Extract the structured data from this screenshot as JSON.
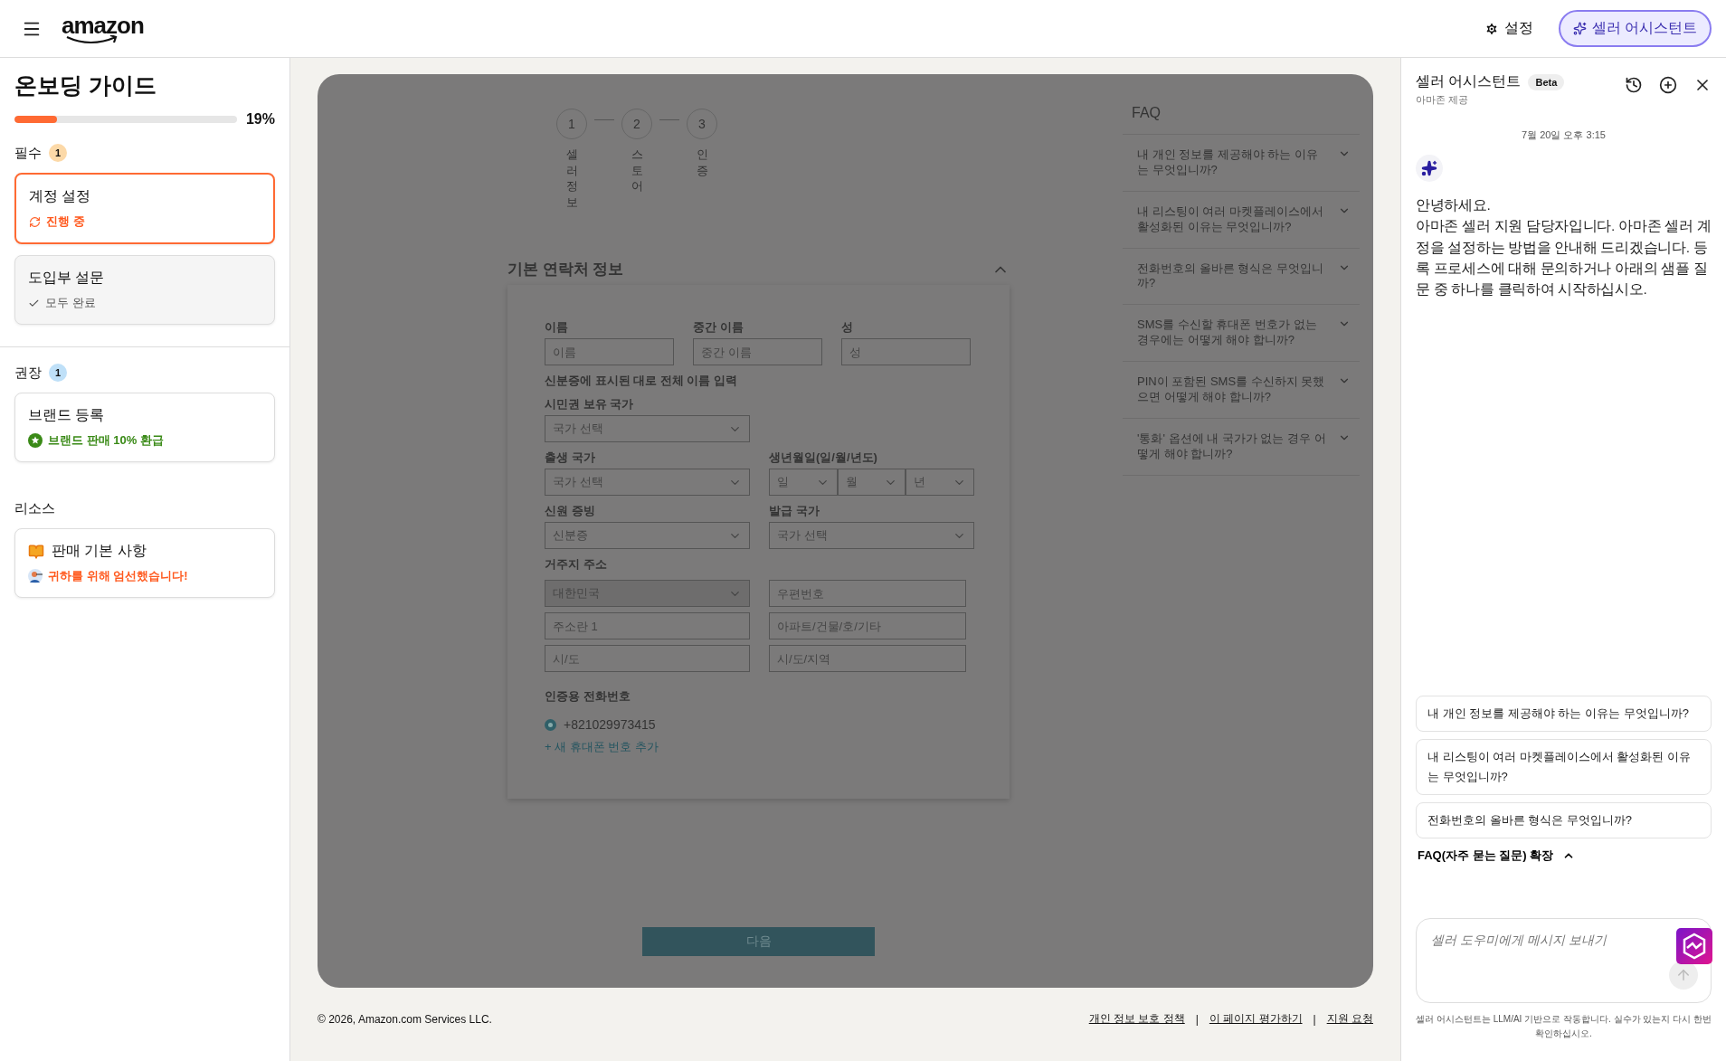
{
  "header": {
    "logo": "amazon",
    "settings": "설정",
    "assistant_button": "셀러 어시스턴트"
  },
  "sidebar": {
    "title": "온보딩 가이드",
    "progress": {
      "level": 0.19,
      "reading": "19%"
    },
    "sections": [
      {
        "title": "필수",
        "count": "1",
        "color": "#fcd9a8",
        "cards": [
          {
            "kind": "in_progress",
            "title": "계정 설정",
            "status": "진행 중",
            "selected": true
          },
          {
            "kind": "done",
            "title": "도입부 설문",
            "status": "모두 완료",
            "selected": false
          }
        ]
      },
      {
        "title": "권장",
        "count": "1",
        "color": "#bfe0f8",
        "cards": [
          {
            "kind": "reward",
            "title": "브랜드 등록",
            "status": "브랜드 판매 10% 환급",
            "selected": false
          }
        ]
      },
      {
        "title": "리소스",
        "cards": [
          {
            "kind": "resource",
            "title": "판매 기본 사항",
            "status": "귀하를 위해 엄선했습니다!",
            "selected": false
          }
        ]
      }
    ]
  },
  "stepper": [
    {
      "number": "1",
      "label": "셀러정보"
    },
    {
      "number": "2",
      "label": "스토어"
    },
    {
      "number": "3",
      "label": "인증"
    }
  ],
  "form": {
    "title": "기본 연락처 정보",
    "expanded": true,
    "rows": [
      {
        "groups": [
          {
            "label": "이름",
            "controls": [
              {
                "kind": "text",
                "placeholder": "이름"
              }
            ]
          },
          {
            "label": "중간 이름",
            "controls": [
              {
                "kind": "text",
                "placeholder": "중간 이름"
              }
            ]
          },
          {
            "label": "성",
            "controls": [
              {
                "kind": "text",
                "placeholder": "성"
              }
            ]
          }
        ],
        "hint": "신분증에 표시된 대로 전체 이름 입력"
      },
      {
        "groups": [
          {
            "label": "시민권 보유 국가",
            "controls": [
              {
                "kind": "select",
                "value": "국가 선택",
                "disabled": false
              }
            ]
          }
        ]
      },
      {
        "groups": [
          {
            "label": "출생 국가",
            "controls": [
              {
                "kind": "select",
                "value": "국가 선택",
                "disabled": false
              }
            ]
          },
          {
            "label": "생년월일(일/월/년도)",
            "controls": [
              {
                "kind": "select",
                "value": "일",
                "disabled": false
              },
              {
                "kind": "select",
                "value": "월",
                "disabled": false
              },
              {
                "kind": "select",
                "value": "년",
                "disabled": false
              }
            ]
          }
        ]
      },
      {
        "groups": [
          {
            "label": "신원 증빙",
            "controls": [
              {
                "kind": "select",
                "value": "신분증",
                "disabled": false
              }
            ]
          },
          {
            "label": "발급 국가",
            "controls": [
              {
                "kind": "select",
                "value": "국가 선택",
                "disabled": false
              }
            ]
          }
        ]
      }
    ],
    "address": {
      "label": "거주지 주소",
      "controls": [
        {
          "kind": "select",
          "value": "대한민국",
          "disabled": true
        },
        {
          "kind": "text",
          "placeholder": "우편번호"
        },
        {
          "kind": "text",
          "placeholder": "주소란 1"
        },
        {
          "kind": "text",
          "placeholder": "아파트/건물/호/기타"
        },
        {
          "kind": "text",
          "placeholder": "시/도"
        },
        {
          "kind": "text",
          "placeholder": "시/도/지역"
        }
      ]
    },
    "phone": {
      "label": "인증용 전화번호",
      "options": [
        {
          "label": "+821029973415",
          "selected": true
        }
      ],
      "add_link": "+ 새 휴대폰 번호 추가"
    },
    "next_button": "다음"
  },
  "faq": {
    "title": "FAQ",
    "items": [
      {
        "text": "내 개인 정보를 제공해야 하는 이유는 무엇입니까?",
        "expanded": false
      },
      {
        "text": "내 리스팅이 여러 마켓플레이스에서 활성화된 이유는 무엇입니까?",
        "expanded": false
      },
      {
        "text": "전화번호의 올바른 형식은 무엇입니까?",
        "expanded": false
      },
      {
        "text": "SMS를 수신할 휴대폰 번호가 없는 경우에는 어떻게 해야 합니까?",
        "expanded": false
      },
      {
        "text": "PIN이 포함된 SMS를 수신하지 못했으면 어떻게 해야 합니까?",
        "expanded": false
      },
      {
        "text": "'통화' 옵션에 내 국가가 없는 경우 어떻게 해야 합니까?",
        "expanded": false
      }
    ]
  },
  "footer": {
    "copyright": "© 2026, Amazon.com Services LLC.",
    "separator": "|",
    "links": [
      "개인 정보 보호 정책",
      "이 페이지 평가하기",
      "지원 요청"
    ]
  },
  "assistant": {
    "title": "셀러 어시스턴트",
    "badge": "Beta",
    "subtitle": "아마존 제공",
    "timestamp": "7월 20일 오후 3:15",
    "message": [
      "안녕하세요.",
      "아마존 셀러 지원 담당자입니다. 아마존 셀러 계정을 설정하는 방법을 안내해 드리겠습니다. 등록 프로세스에 대해 문의하거나 아래의 샘플 질문 중 하나를 클릭하여 시작하십시오."
    ],
    "suggestions": [
      "내 개인 정보를 제공해야 하는 이유는 무엇입니까?",
      "내 리스팅이 여러 마켓플레이스에서 활성화된 이유는 무엇입니까?",
      "전화번호의 올바른 형식은 무엇입니까?"
    ],
    "faq_toggle": {
      "label": "FAQ(자주 묻는 질문) 확장",
      "expanded": true
    },
    "composer": {
      "placeholder": "셀러 도우미에게 메시지 보내기"
    },
    "disclaimer": "셀러 어시스턴트는 LLM/AI 기반으로 작동합니다. 실수가 있는지 다시 한번 확인하십시오."
  }
}
